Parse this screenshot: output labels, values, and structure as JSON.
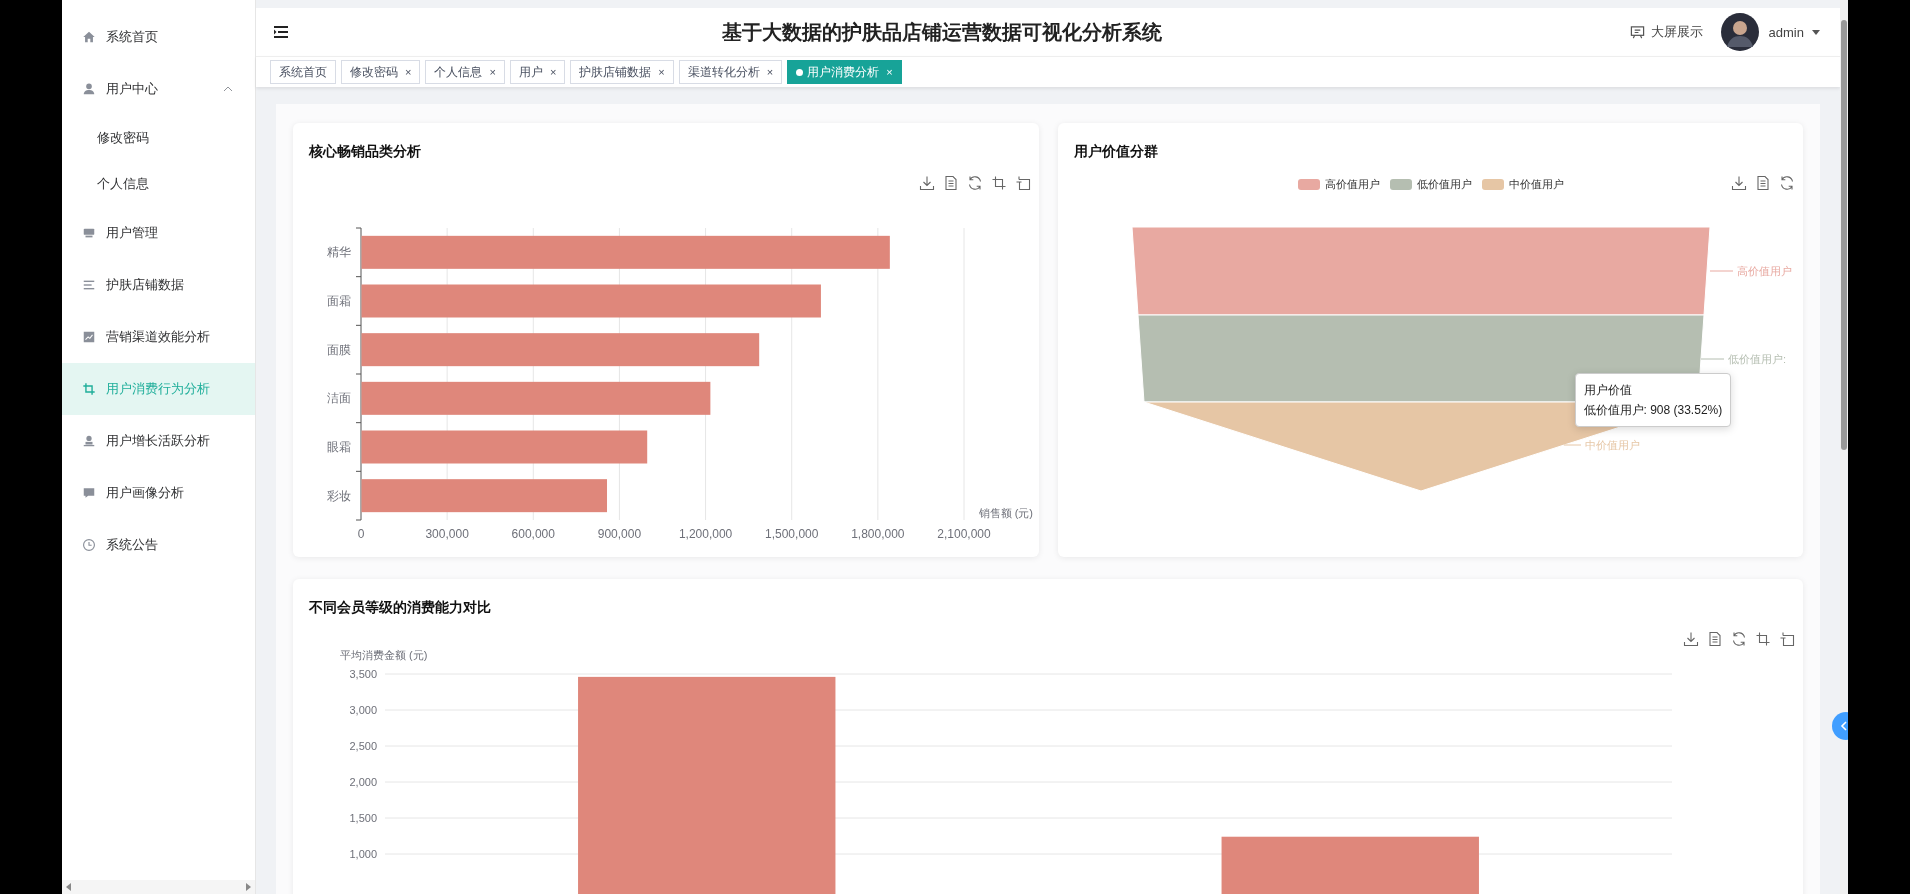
{
  "sidebar": {
    "items": [
      {
        "label": "系统首页",
        "kind": "home",
        "selected": false
      },
      {
        "label": "用户中心",
        "kind": "user",
        "selected": false,
        "expanded": true,
        "children": [
          {
            "label": "修改密码",
            "selected": false
          },
          {
            "label": "个人信息",
            "selected": false
          }
        ]
      },
      {
        "label": "用户管理",
        "kind": "tray",
        "selected": false
      },
      {
        "label": "护肤店铺数据",
        "kind": "list",
        "selected": false
      },
      {
        "label": "营销渠道效能分析",
        "kind": "chart",
        "selected": false
      },
      {
        "label": "用户消费行为分析",
        "kind": "crop",
        "selected": true
      },
      {
        "label": "用户增长活跃分析",
        "kind": "person",
        "selected": false
      },
      {
        "label": "用户画像分析",
        "kind": "chat",
        "selected": false
      },
      {
        "label": "系统公告",
        "kind": "clock",
        "selected": false
      }
    ]
  },
  "header": {
    "title": "基于大数据的护肤品店铺运营数据可视化分析系统",
    "screen_link": "大屏展示",
    "user": "admin"
  },
  "tabs": [
    {
      "label": "系统首页",
      "selected": false
    },
    {
      "label": "修改密码",
      "selected": false,
      "close": "×"
    },
    {
      "label": "个人信息",
      "selected": false,
      "close": "×"
    },
    {
      "label": "用户",
      "selected": false,
      "close": "×"
    },
    {
      "label": "护肤店铺数据",
      "selected": false,
      "close": "×"
    },
    {
      "label": "渠道转化分析",
      "selected": false,
      "close": "×"
    },
    {
      "label": "用户消费分析",
      "selected": true,
      "close": "×"
    }
  ],
  "cards": [
    {
      "kind": "hbar",
      "title": "核心畅销品类分析",
      "toolbox": [
        {
          "kind": "save"
        },
        {
          "kind": "data"
        },
        {
          "kind": "restore"
        },
        {
          "kind": "zoom"
        },
        {
          "kind": "zoom_back"
        }
      ],
      "chart_data": {
        "type": "bar",
        "orientation": "horizontal",
        "grid": true,
        "xlim": [
          0,
          2100000
        ],
        "xlabel": "销售额 (元)",
        "categories": [
          "精华",
          "面霜",
          "面膜",
          "洁面",
          "眼霜",
          "彩妆"
        ],
        "values": [
          1840000,
          1600000,
          1385000,
          1215000,
          995000,
          855000
        ],
        "xticks": [
          {
            "value": 0,
            "label": "0"
          },
          {
            "value": 300000,
            "label": "300,000"
          },
          {
            "value": 600000,
            "label": "600,000"
          },
          {
            "value": 900000,
            "label": "900,000"
          },
          {
            "value": 1200000,
            "label": "1,200,000"
          },
          {
            "value": 1500000,
            "label": "1,500,000"
          },
          {
            "value": 1800000,
            "label": "1,800,000"
          },
          {
            "value": 2100000,
            "label": "2,100,000"
          }
        ]
      }
    },
    {
      "kind": "funnel",
      "title": "用户价值分群",
      "toolbox": [
        {
          "kind": "save"
        },
        {
          "kind": "data"
        },
        {
          "kind": "restore"
        }
      ],
      "legend": [
        {
          "name": "高价值用户",
          "color": "#e8a9a1"
        },
        {
          "name": "低价值用户",
          "color": "#b5beb1"
        },
        {
          "name": "中价值用户",
          "color": "#e6c6a5"
        }
      ],
      "funnel": [
        {
          "label": "高价值用户",
          "color": "#e8a9a1"
        },
        {
          "label": "低价值用户:",
          "color": "#b5beb1"
        },
        {
          "label": "中价值用户",
          "color": "#e6c6a5"
        }
      ],
      "tooltip": {
        "title": "用户价值",
        "text": "低价值用户: 908 (33.52%)"
      }
    },
    {
      "kind": "vbar",
      "title": "不同会员等级的消费能力对比",
      "toolbox": [
        {
          "kind": "save"
        },
        {
          "kind": "data"
        },
        {
          "kind": "restore"
        },
        {
          "kind": "zoom"
        },
        {
          "kind": "zoom_back"
        }
      ],
      "chart_data": {
        "type": "bar",
        "orientation": "vertical",
        "grid": true,
        "ylim": [
          0,
          3500
        ],
        "ylabel": "平均消费金额 (元)",
        "values": [
          3460,
          1240
        ],
        "yticks": [
          {
            "value": 1000,
            "label": "1,000"
          },
          {
            "value": 1500,
            "label": "1,500"
          },
          {
            "value": 2000,
            "label": "2,000"
          },
          {
            "value": 2500,
            "label": "2,500"
          },
          {
            "value": 3000,
            "label": "3,000"
          },
          {
            "value": 3500,
            "label": "3,500"
          }
        ]
      }
    }
  ]
}
